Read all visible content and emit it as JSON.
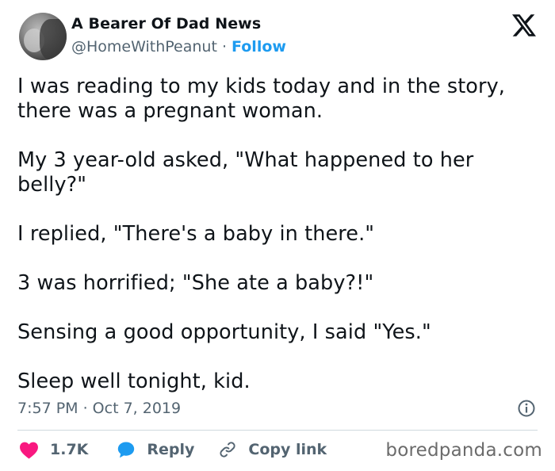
{
  "author": {
    "name": "A Bearer Of Dad News",
    "handle": "@HomeWithPeanut",
    "separator": "·",
    "follow_label": "Follow"
  },
  "platform_icon": "x-logo-icon",
  "tweet": {
    "paragraphs": [
      "I was reading to my kids today and in the story, there was a pregnant woman.",
      "My 3 year-old asked, \"What happened to her belly?\"",
      "I replied, \"There's a baby in there.\"",
      "3 was horrified; \"She ate a baby?!\"",
      "Sensing a good opportunity, I said \"Yes.\"",
      "Sleep well tonight, kid."
    ],
    "timestamp": "7:57 PM · Oct 7, 2019"
  },
  "actions": {
    "likes_count": "1.7K",
    "reply_label": "Reply",
    "copy_link_label": "Copy link"
  },
  "icons": {
    "like": "heart-icon",
    "reply": "speech-bubble-icon",
    "copy": "link-icon",
    "info": "info-icon"
  },
  "watermark": "boredpanda.com",
  "colors": {
    "accent": "#1d9bf0",
    "heart": "#f91880",
    "muted_text": "#536471",
    "text": "#0f1419"
  }
}
